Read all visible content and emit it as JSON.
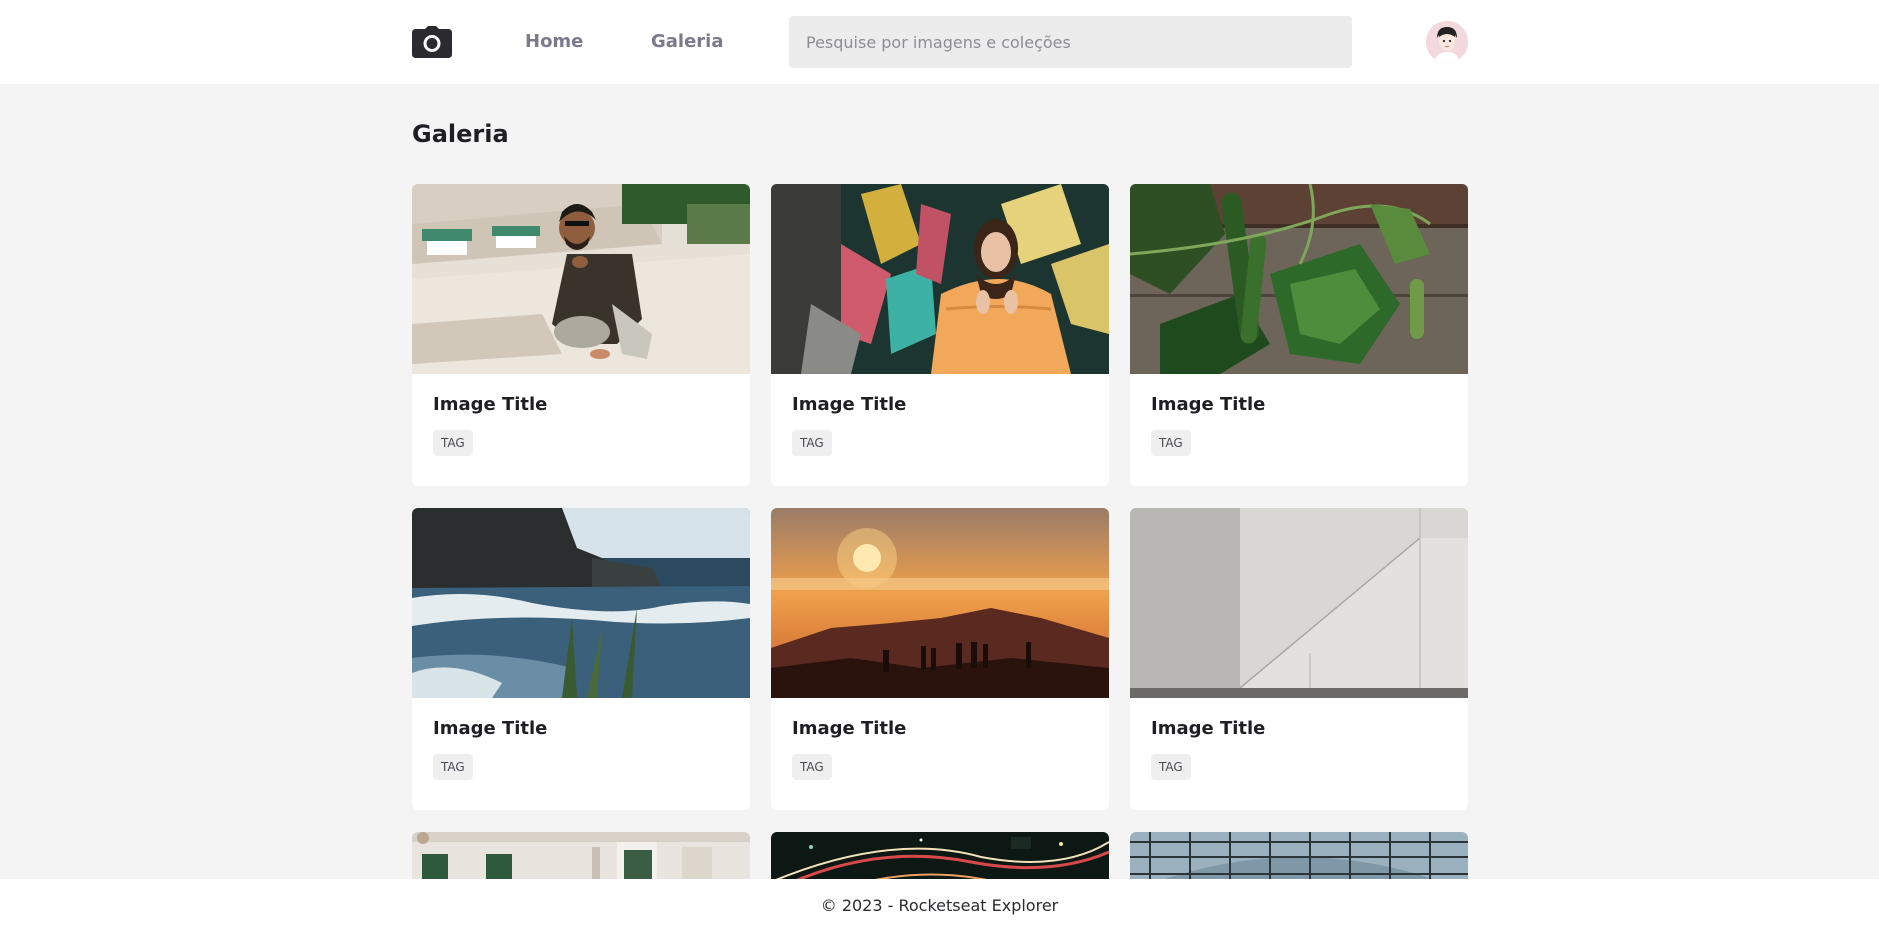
{
  "header": {
    "logo_icon": "camera-icon",
    "nav": {
      "home_label": "Home",
      "galeria_label": "Galeria"
    },
    "search": {
      "placeholder": "Pesquise por imagens e coleções",
      "value": ""
    },
    "avatar_icon": "user-avatar"
  },
  "main": {
    "title": "Galeria",
    "cards": [
      {
        "title": "Image Title",
        "tag": "TAG",
        "image": "man-crouching-on-promenade"
      },
      {
        "title": "Image Title",
        "tag": "TAG",
        "image": "woman-orange-hoodie-mural"
      },
      {
        "title": "Image Title",
        "tag": "TAG",
        "image": "cucumber-plant-on-wood"
      },
      {
        "title": "Image Title",
        "tag": "TAG",
        "image": "ocean-cliff-coast"
      },
      {
        "title": "Image Title",
        "tag": "TAG",
        "image": "sunset-silhouettes-mountain"
      },
      {
        "title": "Image Title",
        "tag": "TAG",
        "image": "white-wall-staircase"
      },
      {
        "image": "building-facade-windows"
      },
      {
        "image": "city-night-light-trails"
      },
      {
        "image": "glass-dome-ceiling"
      }
    ]
  },
  "footer": {
    "text": "© 2023 - Rocketseat Explorer"
  },
  "colors": {
    "background": "#f4f4f4",
    "surface": "#ffffff",
    "nav_text": "#7a7a8c",
    "search_bg": "#ececec",
    "tag_bg": "#efefef"
  }
}
